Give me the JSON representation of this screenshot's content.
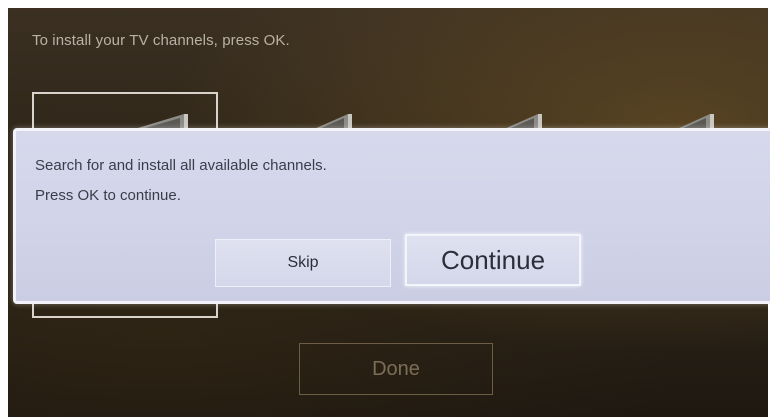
{
  "instruction_text": "To install your TV channels, press OK.",
  "dialog": {
    "line1": "Search for and install all available channels.",
    "line2": "Press OK to continue.",
    "skip_label": "Skip",
    "continue_label": "Continue"
  },
  "background_buttons": {
    "done_label": "Done"
  },
  "colors": {
    "background": "#2c2418",
    "dialog_bg": "#d3d6ea",
    "dialog_border": "#f2f2f8",
    "text_dark": "#3a3d48",
    "instruction_text": "#b9b2a4",
    "done_text": "#7c6d57"
  },
  "icons": [
    "tv-screen-icon",
    "tv-screen-icon",
    "tv-screen-icon",
    "tv-screen-icon"
  ]
}
